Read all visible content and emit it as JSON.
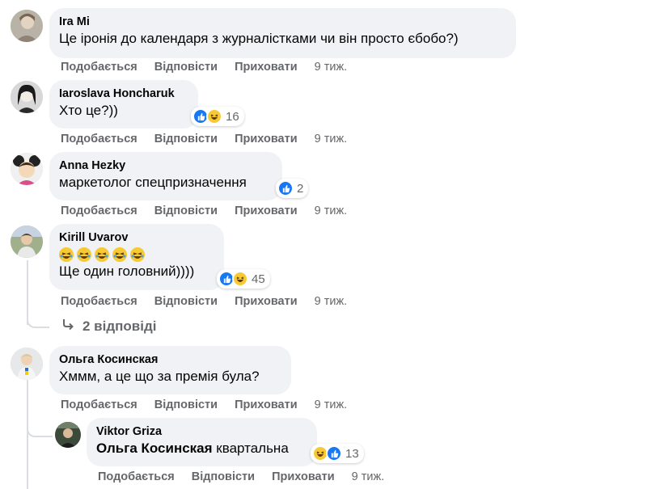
{
  "actions": {
    "like": "Подобається",
    "reply": "Відповісти",
    "hide": "Приховати"
  },
  "comments": [
    {
      "author": "Ira Mi",
      "text": "Це іронія до календаря з журналістками чи він просто єбобо?)",
      "time": "9 тиж."
    },
    {
      "author": "Iaroslava Honcharuk",
      "text": "Хто це?))",
      "time": "9 тиж.",
      "reaction_count": "16"
    },
    {
      "author": "Anna Hezky",
      "text": "маркетолог спецпризначення",
      "time": "9 тиж.",
      "reaction_count": "2"
    },
    {
      "author": "Kirill Uvarov",
      "text": "Ще один головний))))",
      "time": "9 тиж.",
      "reaction_count": "45",
      "replies_label": "2 відповіді"
    },
    {
      "author": "Ольга Косинская",
      "text": "Хммм, а це що за премія була?",
      "time": "9 тиж."
    }
  ],
  "reply": {
    "author": "Viktor Griza",
    "mention": "Ольга Косинская",
    "text": " квартальна",
    "time": "9 тиж.",
    "reaction_count": "13"
  },
  "colors": {
    "bubble": "#f0f2f5",
    "secondary_text": "#65676b",
    "like_blue": "#1877f2",
    "haha_yellow": "#f7c935"
  },
  "icons": [
    "like-icon",
    "haha-icon",
    "reply-arrow-icon"
  ]
}
